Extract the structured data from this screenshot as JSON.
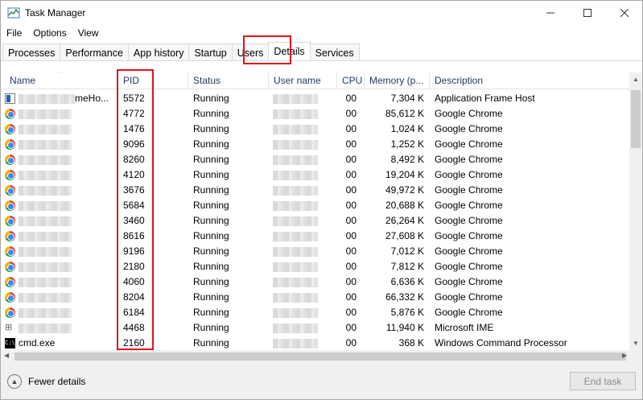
{
  "window": {
    "title": "Task Manager"
  },
  "menu": [
    "File",
    "Options",
    "View"
  ],
  "tabs": [
    "Processes",
    "Performance",
    "App history",
    "Startup",
    "Users",
    "Details",
    "Services"
  ],
  "active_tab": "Details",
  "columns": {
    "name": "Name",
    "pid": "PID",
    "status": "Status",
    "user": "User name",
    "cpu": "CPU",
    "memory": "Memory (p...",
    "description": "Description"
  },
  "rows": [
    {
      "icon": "app-frame-host-icon",
      "name": "meHo...",
      "pid": "5572",
      "status": "Running",
      "cpu": "00",
      "memory": "7,304 K",
      "description": "Application Frame Host"
    },
    {
      "icon": "chrome-icon",
      "name": "",
      "pid": "4772",
      "status": "Running",
      "cpu": "00",
      "memory": "85,612 K",
      "description": "Google Chrome"
    },
    {
      "icon": "chrome-icon",
      "name": "",
      "pid": "1476",
      "status": "Running",
      "cpu": "00",
      "memory": "1,024 K",
      "description": "Google Chrome"
    },
    {
      "icon": "chrome-icon",
      "name": "",
      "pid": "9096",
      "status": "Running",
      "cpu": "00",
      "memory": "1,252 K",
      "description": "Google Chrome"
    },
    {
      "icon": "chrome-icon",
      "name": "",
      "pid": "8260",
      "status": "Running",
      "cpu": "00",
      "memory": "8,492 K",
      "description": "Google Chrome"
    },
    {
      "icon": "chrome-icon",
      "name": "",
      "pid": "4120",
      "status": "Running",
      "cpu": "00",
      "memory": "19,204 K",
      "description": "Google Chrome"
    },
    {
      "icon": "chrome-icon",
      "name": "",
      "pid": "3676",
      "status": "Running",
      "cpu": "00",
      "memory": "49,972 K",
      "description": "Google Chrome"
    },
    {
      "icon": "chrome-icon",
      "name": "",
      "pid": "5684",
      "status": "Running",
      "cpu": "00",
      "memory": "20,688 K",
      "description": "Google Chrome"
    },
    {
      "icon": "chrome-icon",
      "name": "",
      "pid": "3460",
      "status": "Running",
      "cpu": "00",
      "memory": "26,264 K",
      "description": "Google Chrome"
    },
    {
      "icon": "chrome-icon",
      "name": "",
      "pid": "8616",
      "status": "Running",
      "cpu": "00",
      "memory": "27,608 K",
      "description": "Google Chrome"
    },
    {
      "icon": "chrome-icon",
      "name": "",
      "pid": "9196",
      "status": "Running",
      "cpu": "00",
      "memory": "7,012 K",
      "description": "Google Chrome"
    },
    {
      "icon": "chrome-icon",
      "name": "",
      "pid": "2180",
      "status": "Running",
      "cpu": "00",
      "memory": "7,812 K",
      "description": "Google Chrome"
    },
    {
      "icon": "chrome-icon",
      "name": "",
      "pid": "4060",
      "status": "Running",
      "cpu": "00",
      "memory": "6,636 K",
      "description": "Google Chrome"
    },
    {
      "icon": "chrome-icon",
      "name": "",
      "pid": "8204",
      "status": "Running",
      "cpu": "00",
      "memory": "66,332 K",
      "description": "Google Chrome"
    },
    {
      "icon": "chrome-icon",
      "name": "",
      "pid": "6184",
      "status": "Running",
      "cpu": "00",
      "memory": "5,876 K",
      "description": "Google Chrome"
    },
    {
      "icon": "ime-icon",
      "name": "",
      "pid": "4468",
      "status": "Running",
      "cpu": "00",
      "memory": "11,940 K",
      "description": "Microsoft IME"
    },
    {
      "icon": "cmd-icon",
      "name": "cmd.exe",
      "pid": "2160",
      "status": "Running",
      "cpu": "00",
      "memory": "368 K",
      "description": "Windows Command Processor"
    }
  ],
  "footer": {
    "fewer_details": "Fewer details",
    "end_task": "End task"
  },
  "colors": {
    "highlight": "#e0141e",
    "header_text": "#1e395b",
    "footer_bg": "#f0f0f0"
  }
}
